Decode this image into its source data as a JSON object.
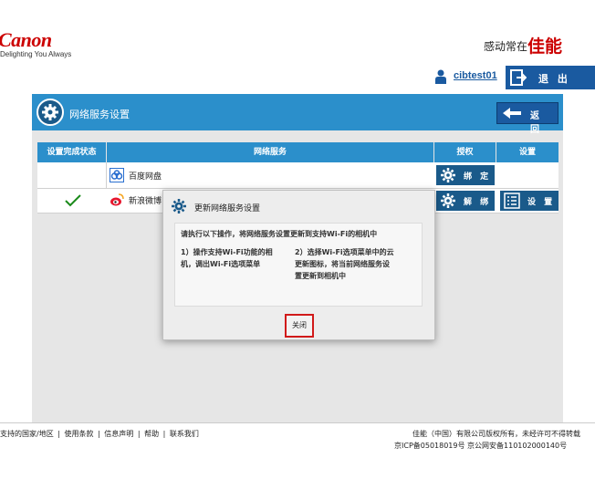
{
  "header": {
    "logo": "Canon",
    "tagline": "Delighting You Always",
    "slogan": "感动常在",
    "slogan_red": "佳能",
    "username": "cibtest01",
    "logout_label": "退 出"
  },
  "page": {
    "title": "网络服务设置",
    "back_label": "返 回"
  },
  "table": {
    "headers": [
      "设置完成状态",
      "网络服务",
      "授权",
      "设置"
    ],
    "rows": [
      {
        "service": "百度网盘",
        "status_check": false,
        "auth_label": "绑 定",
        "settings_label": ""
      },
      {
        "service": "新浪微博",
        "status_check": true,
        "auth_label": "解 绑",
        "settings_label": "设 置"
      }
    ]
  },
  "modal": {
    "title": "更新网络服务设置",
    "instruction": "请执行以下操作，将网络服务设置更新到支持Wi-Fi的相机中",
    "step1": [
      "1）操作支持Wi-Fi功能的相",
      "机，调出Wi-Fi选项菜单"
    ],
    "step2": [
      "2）选择Wi-Fi选项菜单中的云",
      "更新图标，将当前网络服务设",
      "置更新到相机中"
    ],
    "close_label": "关闭"
  },
  "footer": {
    "links": [
      "支持的国家/地区",
      "使用条款",
      "信息声明",
      "帮助",
      "联系我们"
    ],
    "separator": "|",
    "copyright": "佳能（中国）有限公司版权所有，未经许可不得转载",
    "icp": "京ICP备05018019号 京公网安备110102000140号"
  },
  "colors": {
    "primary_blue": "#2b8fcb",
    "dark_blue": "#1a5aa0",
    "canon_red": "#cc0000",
    "check_green": "#1a8a1a",
    "highlight_red": "#d11a1a"
  }
}
